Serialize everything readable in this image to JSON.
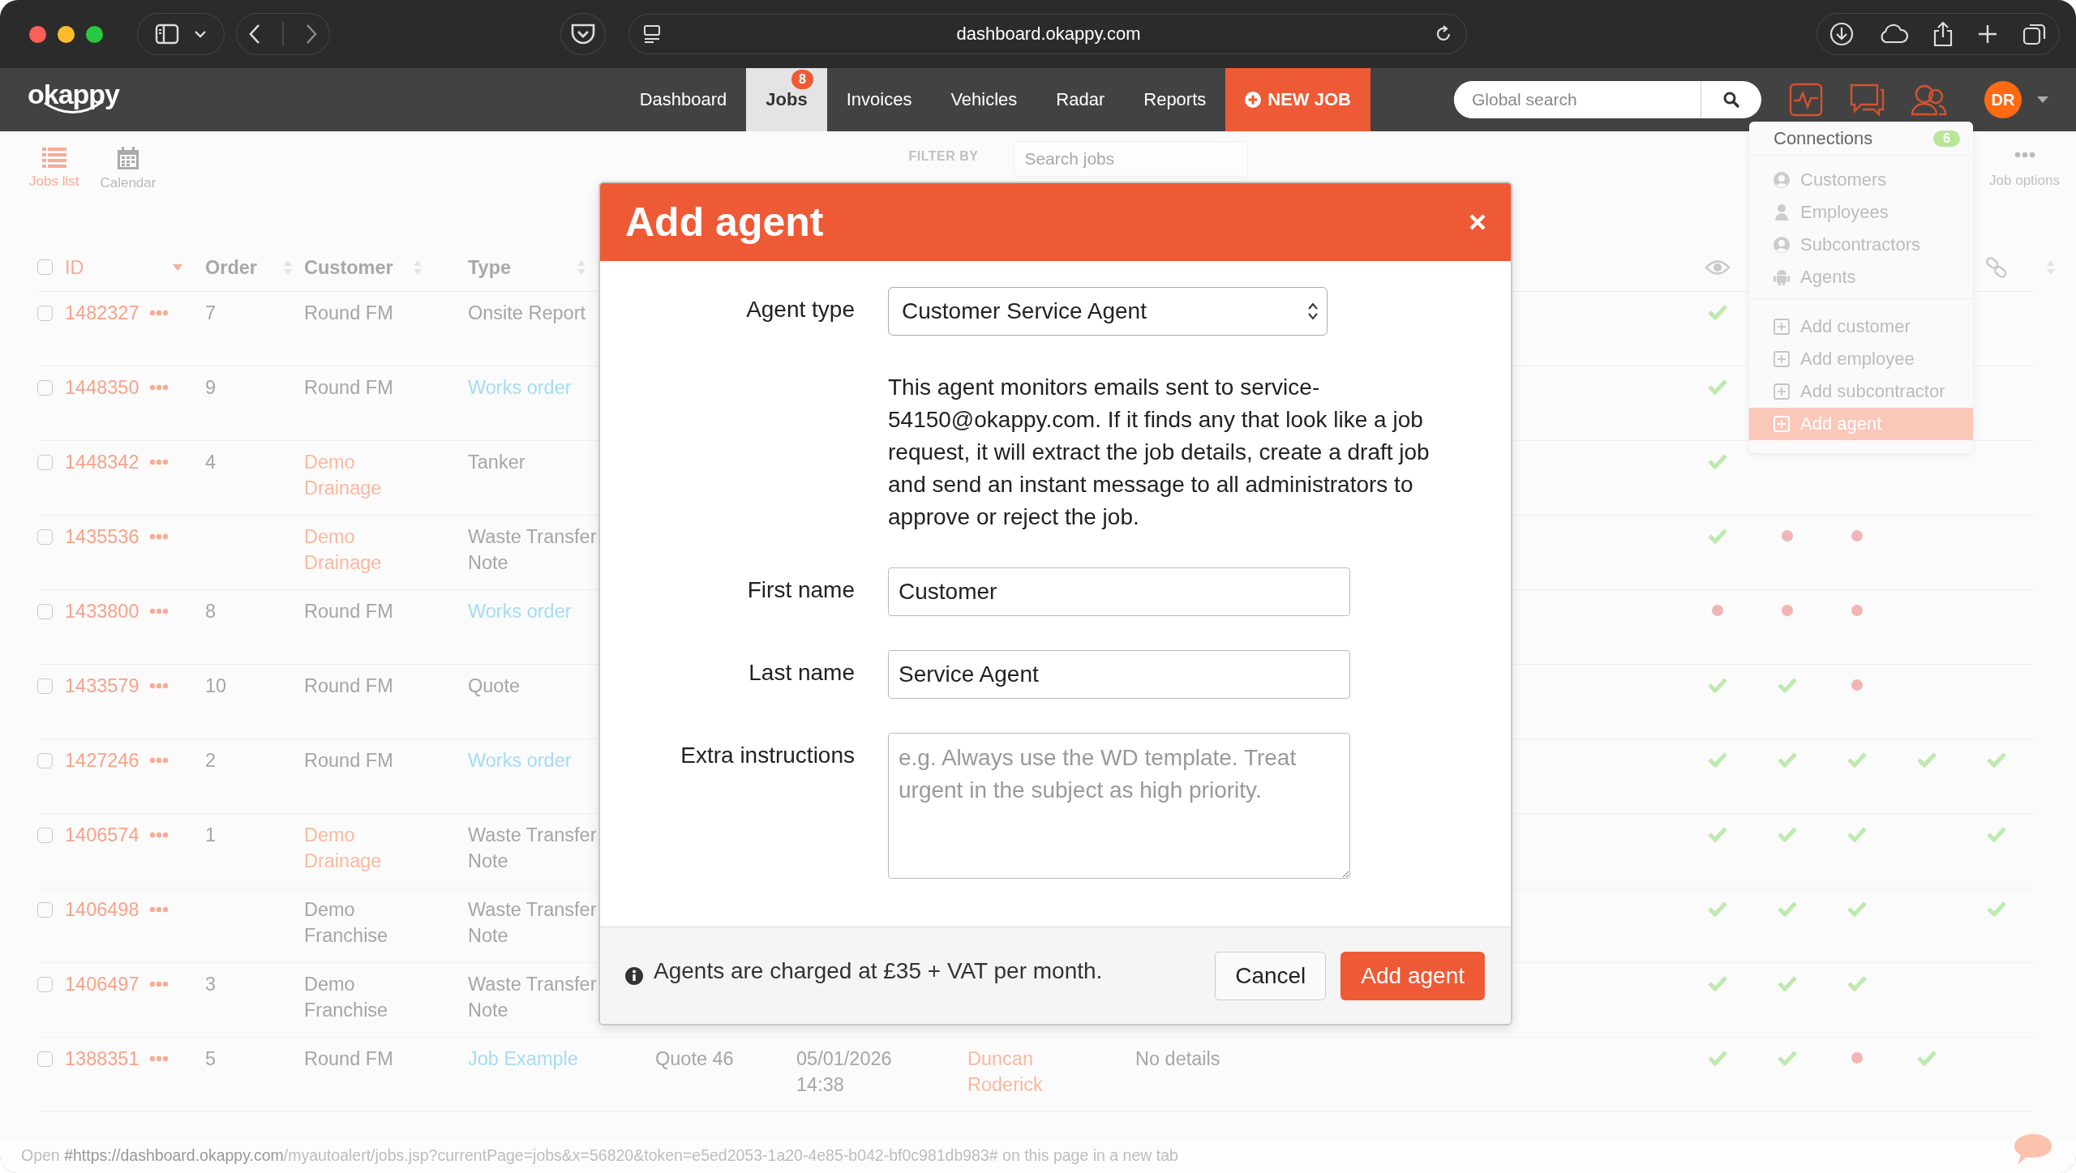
{
  "browser": {
    "url": "dashboard.okappy.com"
  },
  "app": {
    "logo": "okappy",
    "nav": [
      {
        "label": "Dashboard",
        "selected": false
      },
      {
        "label": "Jobs",
        "selected": true,
        "badge": "8"
      },
      {
        "label": "Invoices",
        "selected": false
      },
      {
        "label": "Vehicles",
        "selected": false
      },
      {
        "label": "Radar",
        "selected": false
      },
      {
        "label": "Reports",
        "selected": false
      }
    ],
    "new_job": "NEW JOB",
    "search": {
      "placeholder": "Global search"
    },
    "avatar": "DR"
  },
  "toolbar": {
    "views": [
      {
        "label": "Jobs list",
        "kind": "list",
        "selected": true
      },
      {
        "label": "Calendar",
        "kind": "calendar",
        "selected": false
      }
    ],
    "filter_label": "FILTER BY",
    "search": {
      "placeholder": "Search jobs"
    },
    "options": "Job options"
  },
  "table": {
    "columns": [
      {
        "label": "ID",
        "sorted": true
      },
      {
        "label": "Order",
        "sorted": false
      },
      {
        "label": "Customer",
        "sorted": false
      },
      {
        "label": "Type",
        "sorted": false
      }
    ],
    "all_checked": false,
    "rows": [
      {
        "checked": false,
        "id": "1482327",
        "order": "7",
        "customer": {
          "text": "Round FM",
          "link": false
        },
        "type": {
          "text": "Onsite Report",
          "link": false
        },
        "marks": [
          {
            "kind": "check"
          }
        ]
      },
      {
        "checked": false,
        "id": "1448350",
        "order": "9",
        "customer": {
          "text": "Round FM",
          "link": false
        },
        "type": {
          "text": "Works order",
          "link": true
        },
        "marks": [
          {
            "kind": "check"
          }
        ]
      },
      {
        "checked": false,
        "id": "1448342",
        "order": "4",
        "customer": {
          "text": "Demo Drainage",
          "link": true
        },
        "type": {
          "text": "Tanker",
          "link": false
        },
        "marks": [
          {
            "kind": "check"
          }
        ]
      },
      {
        "checked": false,
        "id": "1435536",
        "customer": {
          "text": "Demo Drainage",
          "link": true
        },
        "type": {
          "text": "Waste Transfer Note",
          "link": false
        },
        "marks": [
          {
            "kind": "check"
          },
          {
            "kind": "dot"
          },
          {
            "kind": "dot"
          }
        ]
      },
      {
        "checked": false,
        "id": "1433800",
        "order": "8",
        "customer": {
          "text": "Round FM",
          "link": false
        },
        "type": {
          "text": "Works order",
          "link": true
        },
        "marks": [
          {
            "kind": "dot"
          },
          {
            "kind": "dot"
          },
          {
            "kind": "dot"
          }
        ]
      },
      {
        "checked": false,
        "id": "1433579",
        "order": "10",
        "customer": {
          "text": "Round FM",
          "link": false
        },
        "type": {
          "text": "Quote",
          "link": false
        },
        "marks": [
          {
            "kind": "check"
          },
          {
            "kind": "check"
          },
          {
            "kind": "dot"
          }
        ]
      },
      {
        "checked": false,
        "id": "1427246",
        "order": "2",
        "customer": {
          "text": "Round FM",
          "link": false
        },
        "type": {
          "text": "Works order",
          "link": true
        },
        "marks": [
          {
            "kind": "check"
          },
          {
            "kind": "check"
          },
          {
            "kind": "check"
          },
          {
            "kind": "check"
          },
          {
            "kind": "check"
          }
        ]
      },
      {
        "checked": false,
        "id": "1406574",
        "order": "1",
        "customer": {
          "text": "Demo Drainage",
          "link": true
        },
        "type": {
          "text": "Waste Transfer Note",
          "link": false
        },
        "marks": [
          {
            "kind": "check"
          },
          {
            "kind": "check"
          },
          {
            "kind": "check"
          },
          {
            "kind": "none"
          },
          {
            "kind": "check"
          }
        ]
      },
      {
        "checked": false,
        "id": "1406498",
        "customer": {
          "text": "Demo Franchise",
          "link": false
        },
        "type": {
          "text": "Waste Transfer Note",
          "link": false
        },
        "marks": [
          {
            "kind": "check"
          },
          {
            "kind": "check"
          },
          {
            "kind": "check"
          },
          {
            "kind": "none"
          },
          {
            "kind": "check"
          }
        ]
      },
      {
        "checked": false,
        "id": "1406497",
        "order": "3",
        "customer": {
          "text": "Demo Franchise",
          "link": false
        },
        "type": {
          "text": "Waste Transfer Note",
          "link": false
        },
        "marks": [
          {
            "kind": "check"
          },
          {
            "kind": "check"
          },
          {
            "kind": "check"
          }
        ]
      },
      {
        "checked": false,
        "id": "1388351",
        "order": "5",
        "customer": {
          "text": "Round FM",
          "link": false
        },
        "type": {
          "text": "Job Example",
          "link": true
        },
        "details": [
          {
            "text": "Quote 46",
            "link": false
          },
          {
            "text": "05/01/2026 14:38",
            "link": false
          },
          {
            "text": "Duncan Roderick",
            "link": true
          },
          {
            "text": "No details",
            "link": false
          }
        ],
        "marks": [
          {
            "kind": "check"
          },
          {
            "kind": "check"
          },
          {
            "kind": "dot"
          },
          {
            "kind": "check"
          }
        ]
      }
    ]
  },
  "menu": {
    "title": "Connections",
    "badge": "6",
    "sections": [
      {
        "items": [
          {
            "label": "Customers",
            "kind": "circle-user",
            "selected": false
          },
          {
            "label": "Employees",
            "kind": "user",
            "selected": false
          },
          {
            "label": "Subcontractors",
            "kind": "circle-user",
            "selected": false
          },
          {
            "label": "Agents",
            "kind": "robot",
            "selected": false
          }
        ]
      },
      {
        "items": [
          {
            "label": "Add customer",
            "kind": "add",
            "selected": false
          },
          {
            "label": "Add employee",
            "kind": "add",
            "selected": false
          },
          {
            "label": "Add subcontractor",
            "kind": "add",
            "selected": false
          },
          {
            "label": "Add agent",
            "kind": "add",
            "selected": true
          }
        ]
      }
    ]
  },
  "modal": {
    "title": "Add agent",
    "agent_type": {
      "label": "Agent type",
      "value": "Customer Service Agent"
    },
    "description": "This agent monitors emails sent to service-54150@okappy.com. If it finds any that look like a job request, it will extract the job details, create a draft job and send an instant message to all administrators to approve or reject the job.",
    "first_name": {
      "label": "First name",
      "value": "Customer"
    },
    "last_name": {
      "label": "Last name",
      "value": "Service Agent"
    },
    "instructions": {
      "label": "Extra instructions",
      "placeholder": "e.g. Always use the WD template. Treat urgent in the subject as high priority."
    },
    "note": "Agents are charged at £35 + VAT per month.",
    "cancel": "Cancel",
    "submit": "Add agent"
  },
  "status_bar": "Open **#https://dashboard.okappy.com**/myautoalert/jobs.jsp?currentPage=jobs&x=56820&token=e5ed2053-1a20-4e85-b042-bf0c981db983# on this page in a new tab"
}
